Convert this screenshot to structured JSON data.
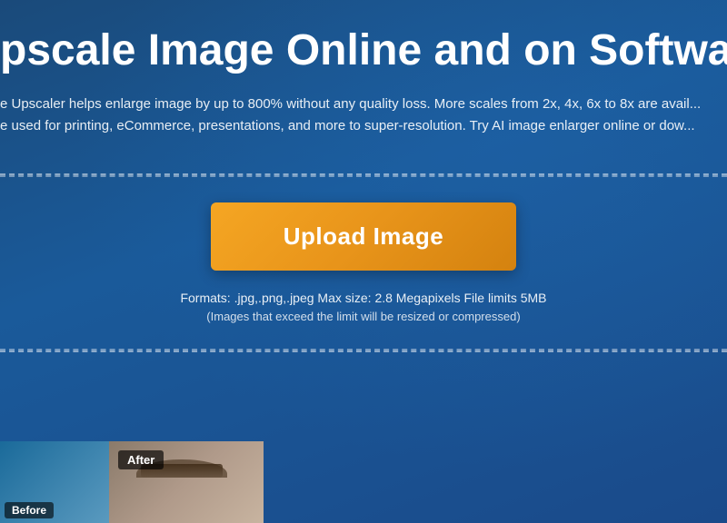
{
  "page": {
    "title": "pscale Image Online and on Software",
    "background_color": "#1a5080"
  },
  "description": {
    "line1": "e Upscaler helps enlarge image by up to 800% without any quality loss. More scales from 2x, 4x, 6x to 8x are avail...",
    "line2": "e used for printing, eCommerce, presentations, and more to super-resolution. Try AI image enlarger online or dow..."
  },
  "upload": {
    "button_label": "Upload Image",
    "formats_label": "Formats: .jpg,.png,.jpeg Max size: 2.8 Megapixels File limits 5MB",
    "note_label": "(Images that exceed the limit will be resized or compressed)"
  },
  "preview": {
    "before_label": "Before",
    "after_label": "After"
  }
}
